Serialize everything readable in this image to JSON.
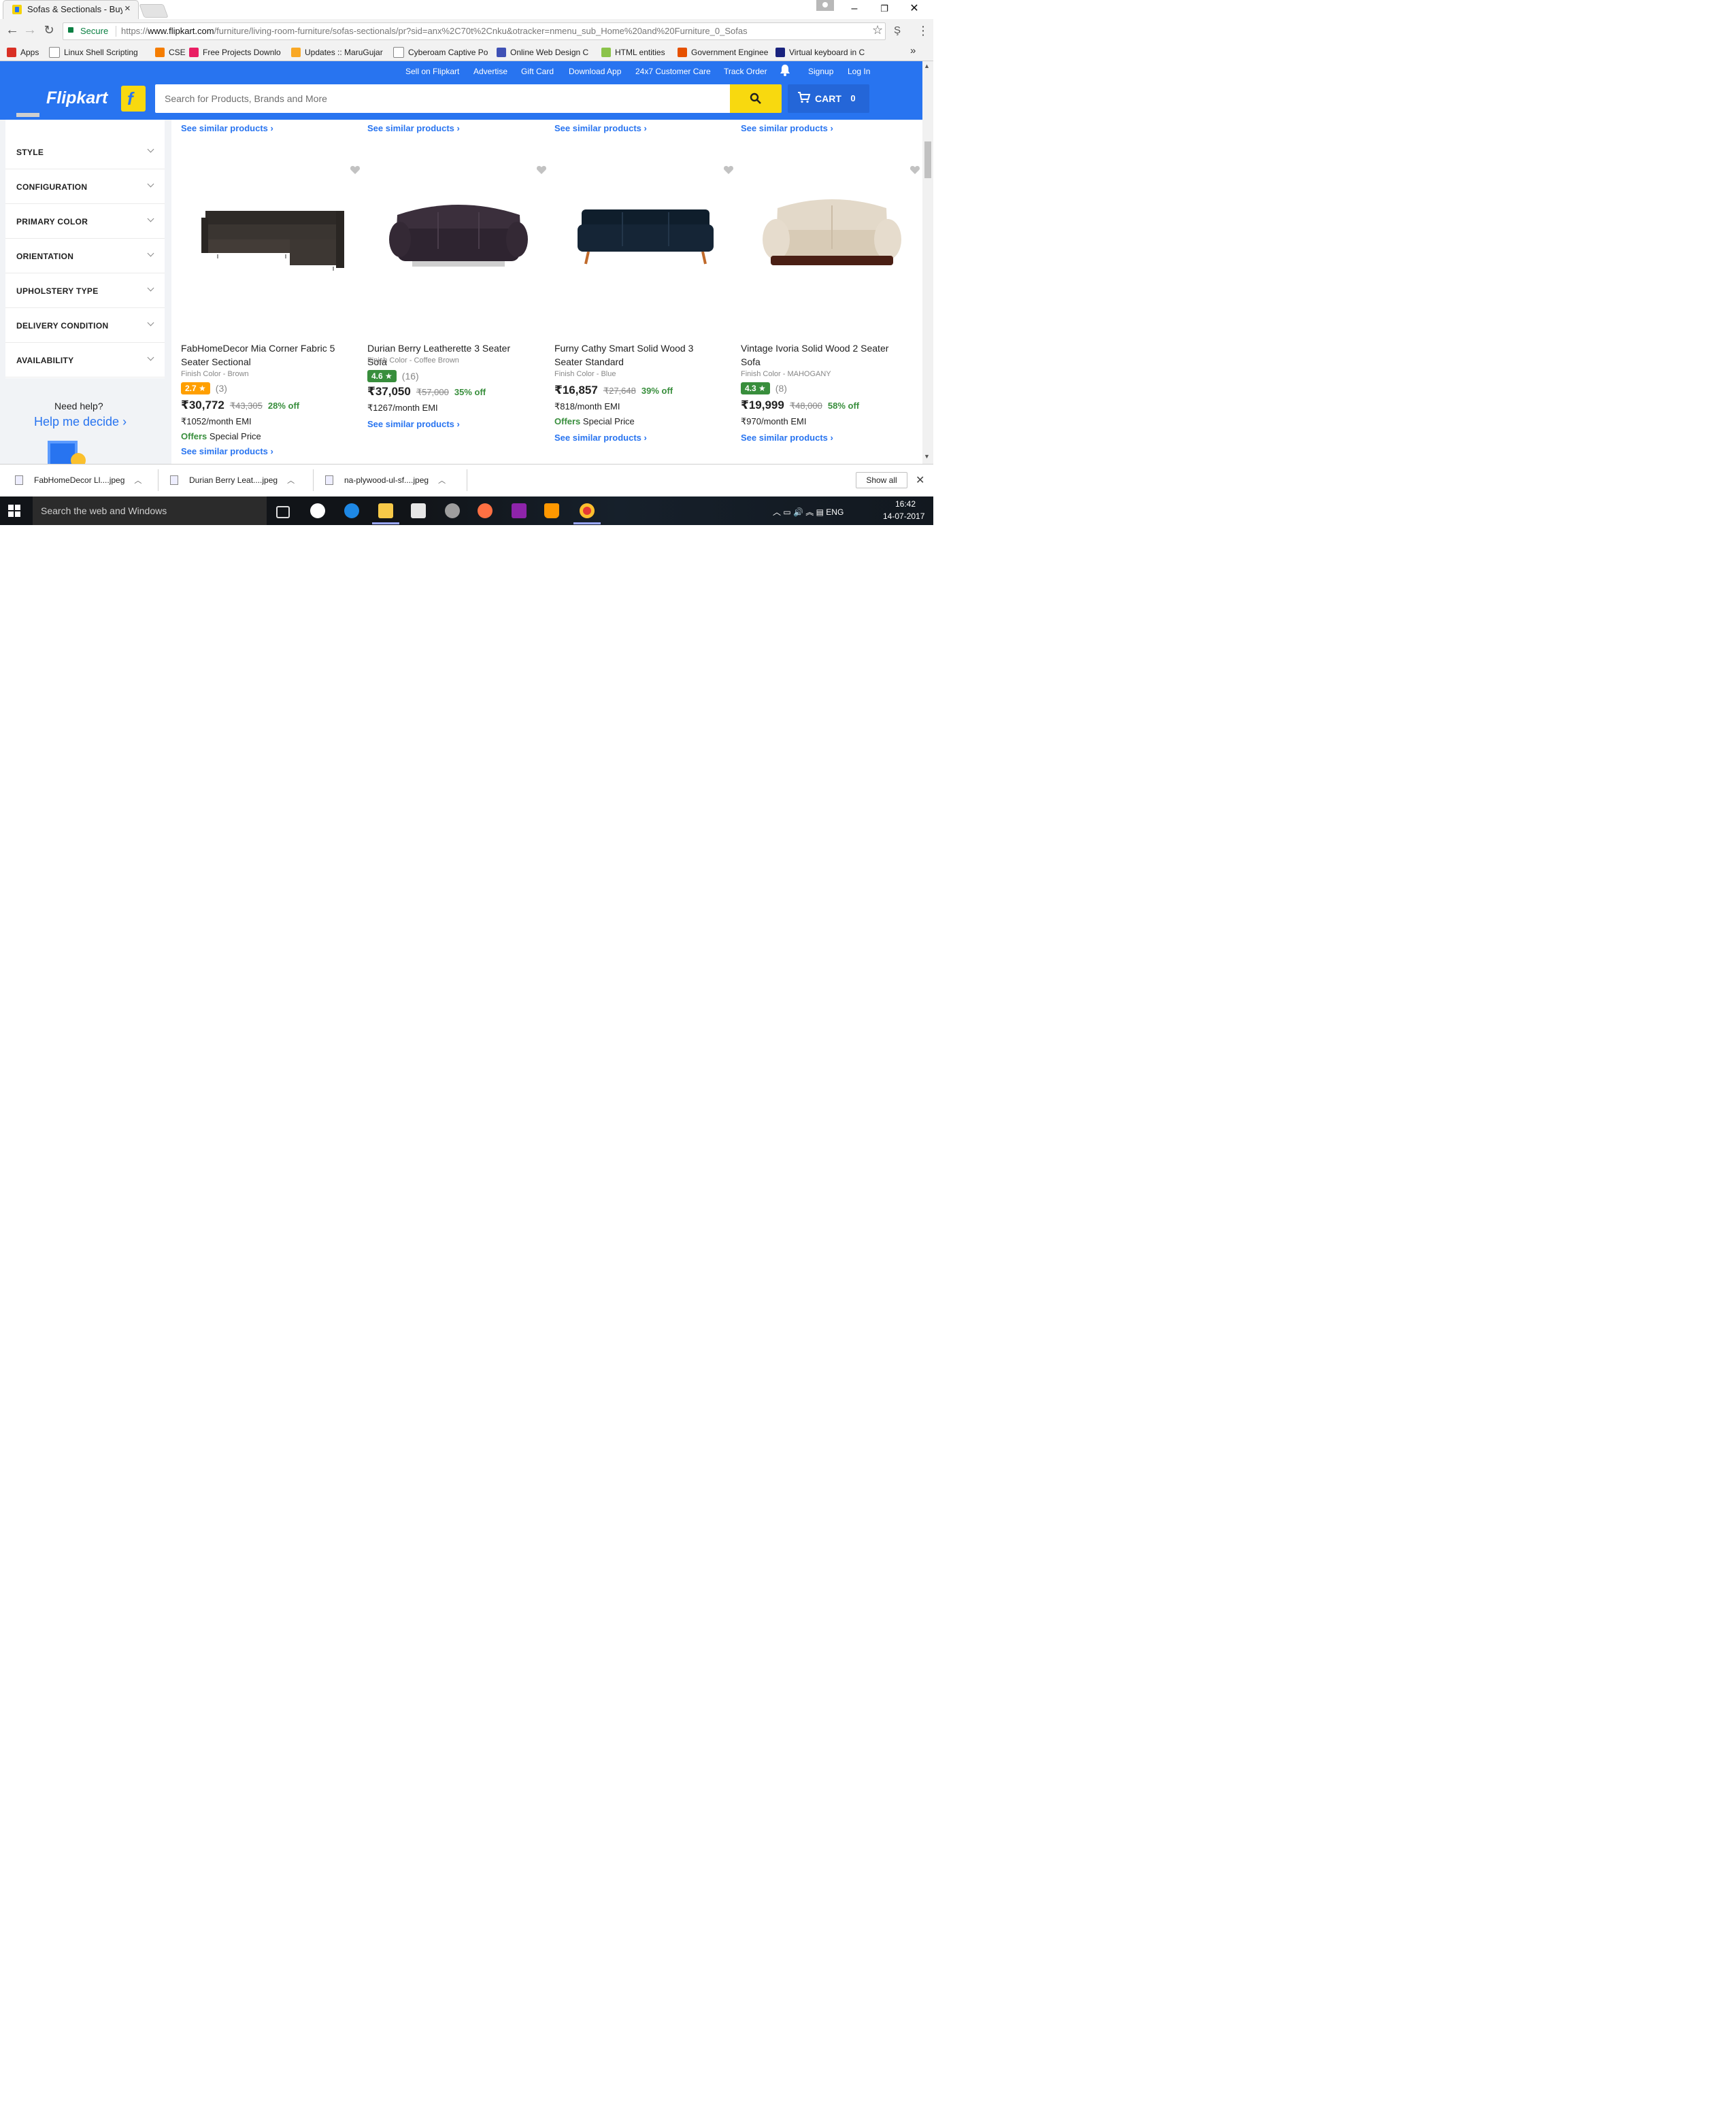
{
  "browser": {
    "tab_title": "Sofas & Sectionals - Buy",
    "secure_label": "Secure",
    "url_scheme": "https://",
    "url_host": "www.flipkart.com",
    "url_path": "/furniture/living-room-furniture/sofas-sectionals/pr?sid=anx%2C70t%2Cnku&otracker=nmenu_sub_Home%20and%20Furniture_0_Sofas",
    "bookmarks": [
      {
        "label": "Apps",
        "icon": "apps-grid-icon",
        "color": "#d93025"
      },
      {
        "label": "Linux Shell Scripting",
        "icon": "page-icon",
        "color": "#ffffff"
      },
      {
        "label": "CSE",
        "icon": "blogger-icon",
        "color": "#f57d00"
      },
      {
        "label": "Free Projects Downlo",
        "icon": "fp-icon",
        "color": "#e91e63"
      },
      {
        "label": "Updates :: MaruGujar",
        "icon": "sun-icon",
        "color": "#f9a825"
      },
      {
        "label": "Cyberoam Captive Po",
        "icon": "page-icon",
        "color": "#ffffff"
      },
      {
        "label": "Online Web Design C",
        "icon": "globe-icon",
        "color": "#3f51b5"
      },
      {
        "label": "HTML entities",
        "icon": "entity-icon",
        "color": "#8bc34a"
      },
      {
        "label": "Government Enginee",
        "icon": "emblem-icon",
        "color": "#e65100"
      },
      {
        "label": "Virtual keyboard in C",
        "icon": "keyboard-icon",
        "color": "#1a237e"
      }
    ]
  },
  "header": {
    "links": [
      "Sell on Flipkart",
      "Advertise",
      "Gift Card",
      "Download App",
      "24x7 Customer Care",
      "Track Order"
    ],
    "signup": "Signup",
    "login": "Log In",
    "logo": "Flipkart",
    "search_placeholder": "Search for Products, Brands and More",
    "cart_label": "CART",
    "cart_count": "0"
  },
  "sidebar": {
    "filters": [
      "STYLE",
      "CONFIGURATION",
      "PRIMARY COLOR",
      "ORIENTATION",
      "UPHOLSTERY TYPE",
      "DELIVERY CONDITION",
      "AVAILABILITY"
    ],
    "need_help": "Need help?",
    "help_link": "Help me decide ›"
  },
  "products": {
    "similar_label": "See similar products ›",
    "offers_label": "Offers",
    "special_price": "Special Price",
    "items": [
      {
        "title": "FabHomeDecor Mia Corner Fabric 5 Seater Sectional",
        "finish": "Finish Color - Brown",
        "rating": "2.7 ★",
        "rating_color": "#ff9f00",
        "reviews": "(3)",
        "price": "₹30,772",
        "mrp": "₹43,305",
        "off": "28% off",
        "emi": "₹1052/month EMI",
        "has_offer": true
      },
      {
        "title": "Durian Berry Leatherette 3 Seater Sofa",
        "finish": "Finish Color - Coffee Brown",
        "rating": "4.6 ★",
        "rating_color": "#388e3c",
        "reviews": "(16)",
        "price": "₹37,050",
        "mrp": "₹57,000",
        "off": "35% off",
        "emi": "₹1267/month EMI",
        "has_offer": false
      },
      {
        "title": "Furny Cathy Smart Solid Wood 3 Seater Standard",
        "finish": "Finish Color - Blue",
        "rating": "",
        "rating_color": "",
        "reviews": "",
        "price": "₹16,857",
        "mrp": "₹27,648",
        "off": "39% off",
        "emi": "₹818/month EMI",
        "has_offer": true
      },
      {
        "title": "Vintage Ivoria Solid Wood 2 Seater Sofa",
        "finish": "Finish Color - MAHOGANY",
        "rating": "4.3 ★",
        "rating_color": "#388e3c",
        "reviews": "(8)",
        "price": "₹19,999",
        "mrp": "₹48,000",
        "off": "58% off",
        "emi": "₹970/month EMI",
        "has_offer": false
      }
    ]
  },
  "downloads": {
    "items": [
      "FabHomeDecor Ll....jpeg",
      "Durian Berry Leat....jpeg",
      "na-plywood-ul-sf....jpeg"
    ],
    "show_all": "Show all"
  },
  "taskbar": {
    "search_text": "Search the web and Windows",
    "language": "ENG",
    "time": "16:42",
    "date": "14-07-2017"
  }
}
